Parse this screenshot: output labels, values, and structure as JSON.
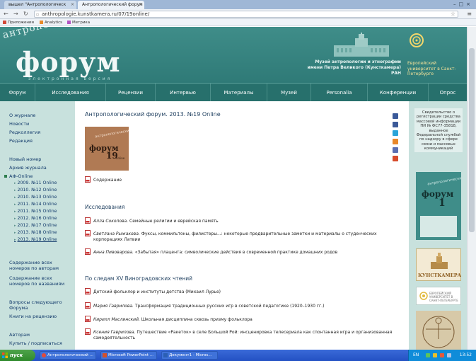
{
  "browser": {
    "tabs": [
      {
        "label": "вышел \"Антропологическ"
      },
      {
        "label": "Антропологический форум"
      }
    ],
    "url": "anthropologie.kunstkamera.ru/07/19online/",
    "bookmarks": [
      "Приложения",
      "Analytics",
      "Метрика"
    ]
  },
  "header": {
    "logo_arc": "антропологический",
    "logo_main": "форум",
    "logo_sub": "электронная версия",
    "museum_text": "Музей антропологии и этнографии имени Петра Великого (Кунсткамера) РАН",
    "eu_text": "Европейский университет в Санкт-Петербурге"
  },
  "nav": {
    "items": [
      "Форум",
      "Исследования",
      "Рецензии",
      "Интервью",
      "Материалы",
      "Музей",
      "Personalia",
      "Конференции",
      "Опрос"
    ]
  },
  "sidebar": {
    "group1": [
      "О журнале",
      "Новости",
      "Редколлегия",
      "Редакция"
    ],
    "group2": [
      "Новый номер",
      "Архив журнала"
    ],
    "af_online": "АФ-Online",
    "issues": [
      "2009. №11 Online",
      "2010. №12 Online",
      "2010. №13 Online",
      "2011. №14 Online",
      "2011. №15 Online",
      "2012. №16 Online",
      "2012. №17 Online",
      "2013. №18 Online",
      "2013. №19 Online"
    ],
    "group3": [
      "Содержание всех номеров по авторам",
      "Содержание всех номеров по названиям"
    ],
    "group4": [
      "Вопросы следующего Форума",
      "Книги на рецензию"
    ],
    "group5": [
      "Авторам",
      "Купить / подписаться"
    ]
  },
  "content": {
    "title": "Антропологический форум. 2013. №19 Online",
    "cover": {
      "arc": "антропологический",
      "main": "форум",
      "num": "19",
      "tag": "online"
    },
    "toc_label": "Содержание",
    "section1": "Исследования",
    "section1_items": [
      {
        "author": "Алла Соколова.",
        "title": " Семейные религии и еврейская память"
      },
      {
        "author": "Светлана Рыжакова.",
        "title": " Фуксы, коммильтоны, филистеры...: некоторые предварительные заметки и материалы о студенческих корпорациях Латвии"
      },
      {
        "author": "Анна Пивоварова.",
        "title": " «Забытая» плацента: символические действия в современной практике домашних родов"
      }
    ],
    "section2": "По следам XV Виноградовских чтений",
    "section2_items": [
      {
        "author": "",
        "title": "Детский фольклор и институты детства (Михаил Лурье)"
      },
      {
        "author": "Мария Гаврилова.",
        "title": " Трансформация традиционных русских игр в советской педагогике (1920–1930 гг.)"
      },
      {
        "author": "Кирилл Маслинский.",
        "title": " Школьная дисциплина сквозь призму фольклора"
      },
      {
        "author": "Ксения Гаврилова.",
        "title": " Путешествие «Ракеток» в селе Большой Рой: инсценировка телесериала как спонтанная игра и организованная самодеятельность"
      }
    ],
    "share_colors": [
      "#3b5a9a",
      "#3b5998",
      "#2aa4d8",
      "#e8882a",
      "#5a6fb3",
      "#d74b2c"
    ]
  },
  "right": {
    "reg_text": "Свидетельство о регистрации средства массовой информации ПИ № ФС77-35818, выданное Федеральной службой по надзору в сфере связи и массовых коммуникаций",
    "cover": {
      "arc": "антропологический",
      "main": "форум",
      "num": "1"
    },
    "kunst_label": "КУНСТКАМЕРА",
    "eu_small": "ЕВРОПЕЙСКИЙ УНИВЕРСИТЕТ В САНКТ-ПЕТЕРБУРГЕ"
  },
  "taskbar": {
    "start": "пуск",
    "buttons": [
      "Антропологический ...",
      "Microsoft PowerPoint ...",
      "Документ1 - Micros..."
    ],
    "lang": "EN",
    "clock": "13:52"
  }
}
